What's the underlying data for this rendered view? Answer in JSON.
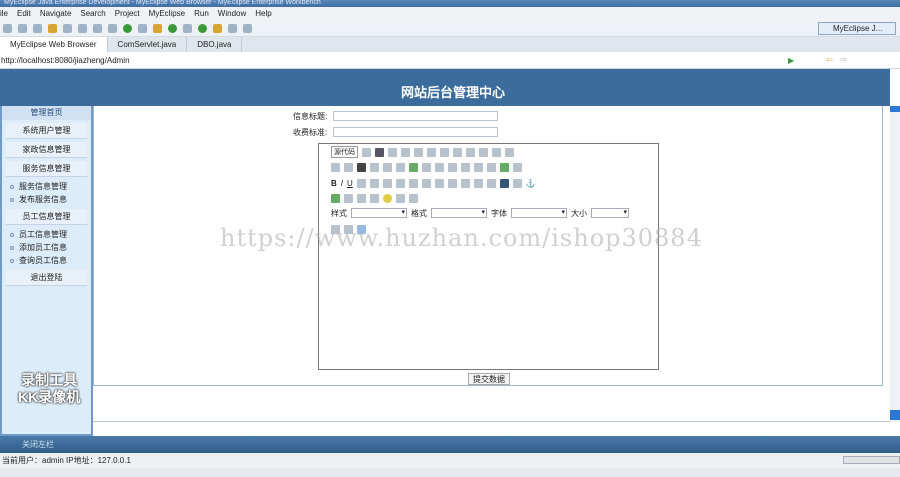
{
  "window": {
    "title": "MyEclipse Java Enterprise Development - MyEclipse Web Browser - MyEclipse Enterprise Workbench"
  },
  "menu": [
    "ile",
    "Edit",
    "Navigate",
    "Search",
    "Project",
    "MyEclipse",
    "Run",
    "Window",
    "Help"
  ],
  "perspective": "MyEclipse J...",
  "tabs": [
    {
      "label": "MyEclipse Web Browser"
    },
    {
      "label": "ComServlet.java"
    },
    {
      "label": "DBO.java"
    }
  ],
  "url": "http://localhost:8080/jiazheng/Admin",
  "page": {
    "title": "网站后台管理中心"
  },
  "sidebar": {
    "head": "管理首页",
    "items": [
      "系统用户管理",
      "家政信息管理",
      "服务信息管理",
      "服务信息管理",
      "发布服务信息",
      "员工信息管理",
      "员工信息管理",
      "添加员工信息",
      "查询员工信息",
      "退出登陆"
    ]
  },
  "form": {
    "title_label": "信息标题:",
    "fee_label": "收费标准:",
    "submit": "提交数据"
  },
  "editor": {
    "source": "源代码",
    "style_label": "样式",
    "format_label": "格式",
    "font_label": "字体",
    "size_label": "大小"
  },
  "footer": {
    "close_left": "关闭左栏",
    "status": "当前用户：admin  IP地址：127.0.0.1"
  },
  "watermark": {
    "url": "https://www.huzhan.com/ishop30884",
    "kk1": "录制工具",
    "kk2": "KK录像机"
  },
  "colors": {
    "header": "#3c6c9b",
    "sidebar": "#dcecf8"
  }
}
